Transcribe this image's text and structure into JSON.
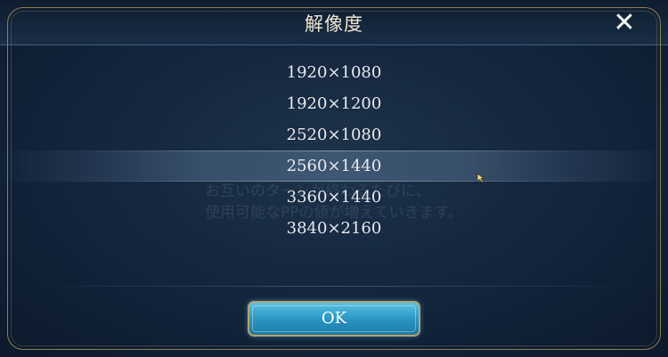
{
  "dialog": {
    "title": "解像度",
    "close_icon": "close-icon",
    "close_glyph": "✕"
  },
  "background_text": {
    "line1": "お互いのターンが終わるたびに、",
    "line2": "使用可能なPPの値が増えていきます。"
  },
  "resolutions": [
    {
      "label": "1920×1080",
      "selected": false
    },
    {
      "label": "1920×1200",
      "selected": false
    },
    {
      "label": "2520×1080",
      "selected": false
    },
    {
      "label": "2560×1440",
      "selected": true
    },
    {
      "label": "3360×1440",
      "selected": false
    },
    {
      "label": "3840×2160",
      "selected": false
    }
  ],
  "ok_button": {
    "label": "OK"
  },
  "colors": {
    "accent": "#2b97c4",
    "border_gold": "#b7a06c",
    "text": "#e6e8ec"
  }
}
